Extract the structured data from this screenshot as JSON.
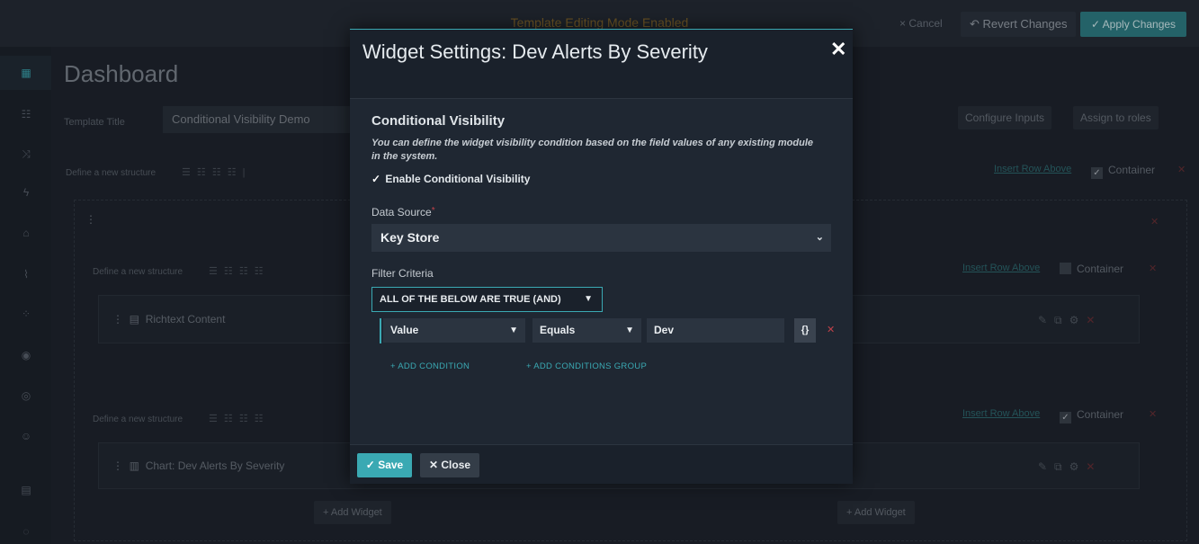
{
  "topbar": {
    "mode_text": "Template Editing Mode Enabled",
    "cancel": "Cancel",
    "revert": "Revert Changes",
    "apply": "Apply Changes"
  },
  "page": {
    "title": "Dashboard",
    "template_title_label": "Template Title",
    "template_title_value": "Conditional Visibility Demo",
    "configure_inputs": "Configure Inputs",
    "assign_roles": "Assign to roles",
    "define_structure": "Define a new structure",
    "insert_row_above": "Insert Row Above",
    "container": "Container",
    "richtext": "Richtext Content",
    "chart": "Chart: Dev Alerts By Severity",
    "add_widget": "Add Widget"
  },
  "modal": {
    "title": "Widget Settings: Dev Alerts By Severity",
    "section_title": "Conditional Visibility",
    "description": "You can define the widget visibility condition based on the field values of any existing module in the system.",
    "enable_label": "Enable Conditional Visibility",
    "enable_checked": true,
    "data_source_label": "Data Source",
    "data_source_value": "Key Store",
    "filter_label": "Filter Criteria",
    "logic_value": "ALL OF THE BELOW ARE TRUE (AND)",
    "condition": {
      "field": "Value",
      "operator": "Equals",
      "value": "Dev",
      "expr_button": "{}"
    },
    "add_condition": "+ ADD CONDITION",
    "add_group": "+ ADD CONDITIONS GROUP",
    "save": "Save",
    "close": "Close"
  },
  "colors": {
    "accent": "#3aa9b3",
    "danger": "#c0424a",
    "modal_bg": "#1f2732"
  }
}
